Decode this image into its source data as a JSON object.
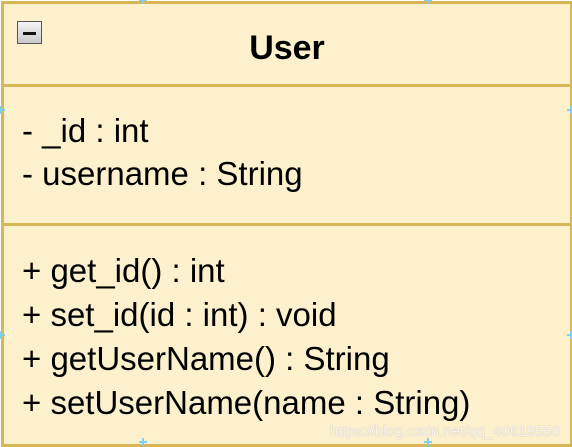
{
  "uml_class": {
    "name": "User",
    "collapse_icon": "minus-box-icon",
    "attributes": [
      "- _id : int",
      "- username : String"
    ],
    "operations": [
      "+ get_id() : int",
      "+ set_id(id : int) : void",
      "+ getUserName() : String",
      "+ setUserName(name : String)"
    ]
  },
  "colors": {
    "fill": "#fdf0cc",
    "border": "#d6b656",
    "selection_handle": "#7fcff3"
  },
  "watermark": "https://blog.csdn.net/qq_40619550"
}
